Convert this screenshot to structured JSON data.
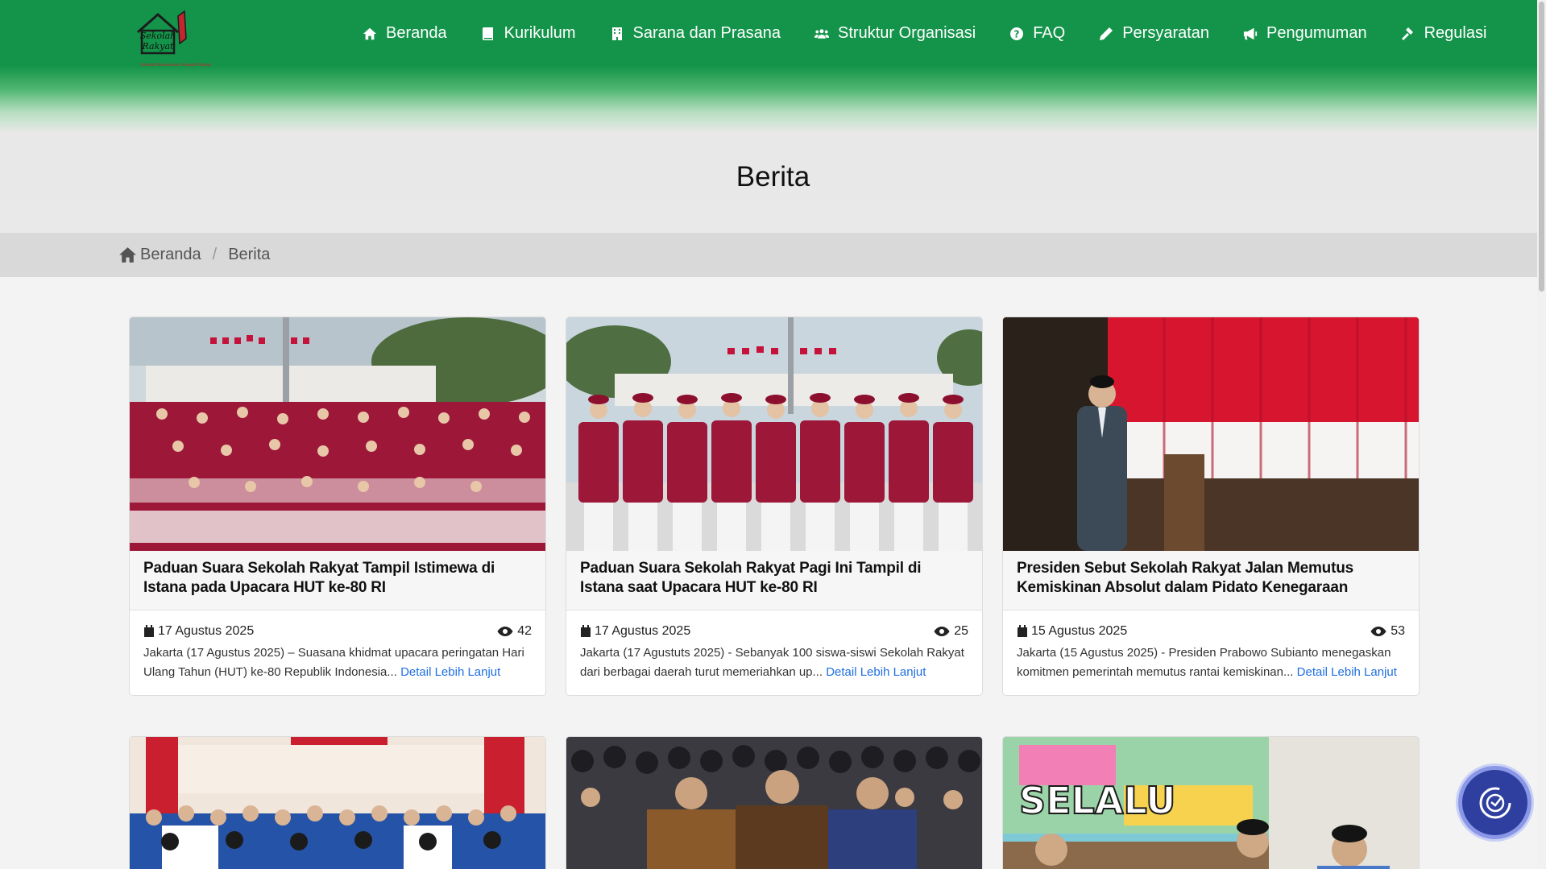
{
  "logo": {
    "line1": "Sekolah",
    "line2": "Rakyat",
    "tagline": "Sekolah Berasrama Terpadu Rakyat"
  },
  "nav": [
    {
      "label": "Beranda",
      "icon": "home-icon"
    },
    {
      "label": "Kurikulum",
      "icon": "book-icon"
    },
    {
      "label": "Sarana dan Prasana",
      "icon": "building-icon"
    },
    {
      "label": "Struktur Organisasi",
      "icon": "users-icon"
    },
    {
      "label": "FAQ",
      "icon": "question-circle-icon"
    },
    {
      "label": "Persyaratan",
      "icon": "pencil-icon"
    },
    {
      "label": "Pengumuman",
      "icon": "megaphone-icon"
    },
    {
      "label": "Regulasi",
      "icon": "gavel-icon"
    }
  ],
  "page_title": "Berita",
  "breadcrumb": {
    "home": "Beranda",
    "current": "Berita"
  },
  "colors": {
    "brand_green": "#14944a",
    "link_blue": "#1f6fe0",
    "accessibility_button": "#2e3fa0"
  },
  "articles": [
    {
      "title": "Paduan Suara Sekolah Rakyat Tampil Istimewa di Istana pada Upacara HUT ke-80 RI",
      "date": "17 Agustus 2025",
      "views": "42",
      "excerpt": "Jakarta (17 Agustus 2025) – Suasana khidmat upacara peringatan Hari Ulang Tahun (HUT) ke-80 Republik Indonesia...",
      "link": "Detail Lebih Lanjut"
    },
    {
      "title": "Paduan Suara Sekolah Rakyat Pagi Ini Tampil di Istana saat Upacara HUT ke-80 RI",
      "date": "17 Agustus 2025",
      "views": "25",
      "excerpt": "Jakarta (17 Agustuts 2025) - Sebanyak 100 siswa-siswi Sekolah Rakyat dari berbagai daerah turut memeriahkan up...",
      "link": "Detail Lebih Lanjut"
    },
    {
      "title": "Presiden Sebut Sekolah Rakyat Jalan Memutus Kemiskinan Absolut dalam Pidato Kenegaraan",
      "date": "15 Agustus 2025",
      "views": "53",
      "excerpt": "Jakarta (15 Agustus 2025) - Presiden Prabowo Subianto menegaskan komitmen pemerintah memutus rantai kemiskinan...",
      "link": "Detail Lebih Lanjut"
    }
  ]
}
